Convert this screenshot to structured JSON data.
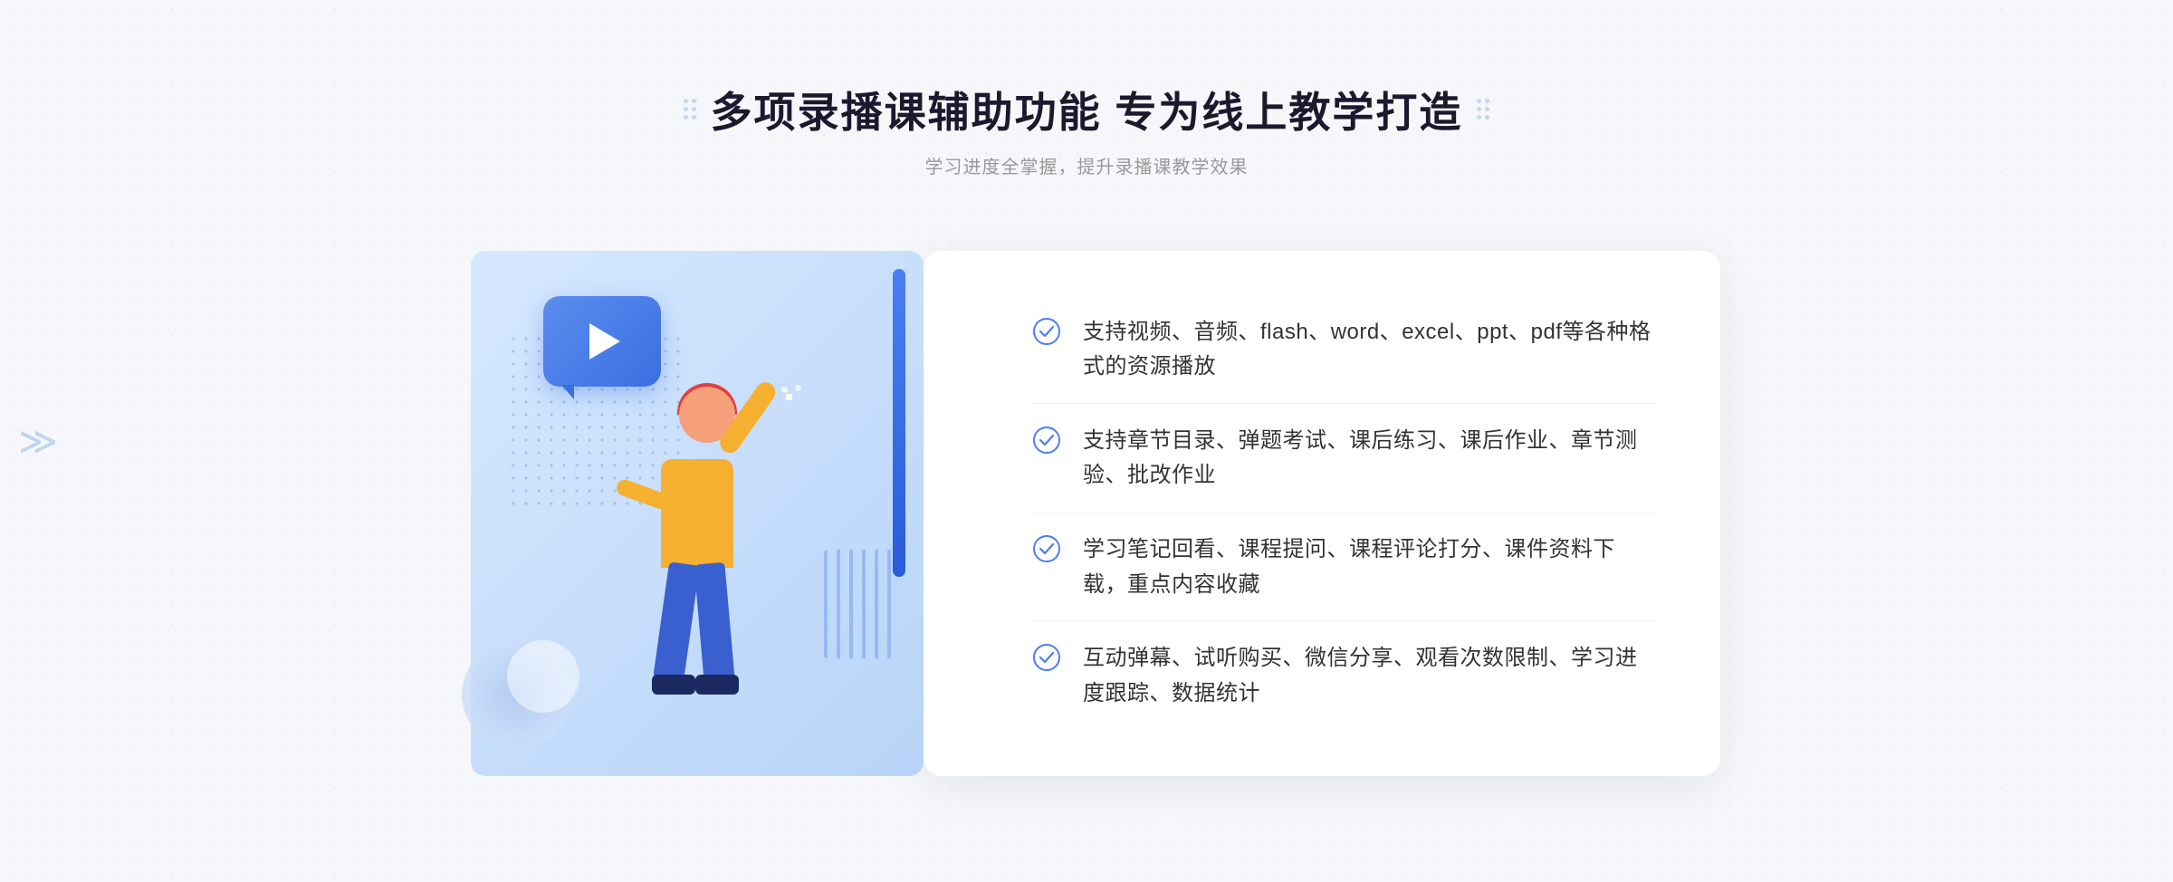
{
  "header": {
    "title": "多项录播课辅助功能 专为线上教学打造",
    "subtitle": "学习进度全掌握，提升录播课教学效果",
    "title_dots_label": "decorative dots"
  },
  "features": [
    {
      "id": 1,
      "text": "支持视频、音频、flash、word、excel、ppt、pdf等各种格式的资源播放"
    },
    {
      "id": 2,
      "text": "支持章节目录、弹题考试、课后练习、课后作业、章节测验、批改作业"
    },
    {
      "id": 3,
      "text": "学习笔记回看、课程提问、课程评论打分、课件资料下载，重点内容收藏"
    },
    {
      "id": 4,
      "text": "互动弹幕、试听购买、微信分享、观看次数限制、学习进度跟踪、数据统计"
    }
  ],
  "icons": {
    "check": "check-circle-icon",
    "left_chevron": "chevron-left-icon",
    "play": "play-icon"
  },
  "colors": {
    "accent_blue": "#4a7ef5",
    "text_dark": "#1a1a2e",
    "text_sub": "#999999",
    "text_feature": "#333333",
    "check_color": "#4a7ef5",
    "bg": "#f5f7fa"
  }
}
